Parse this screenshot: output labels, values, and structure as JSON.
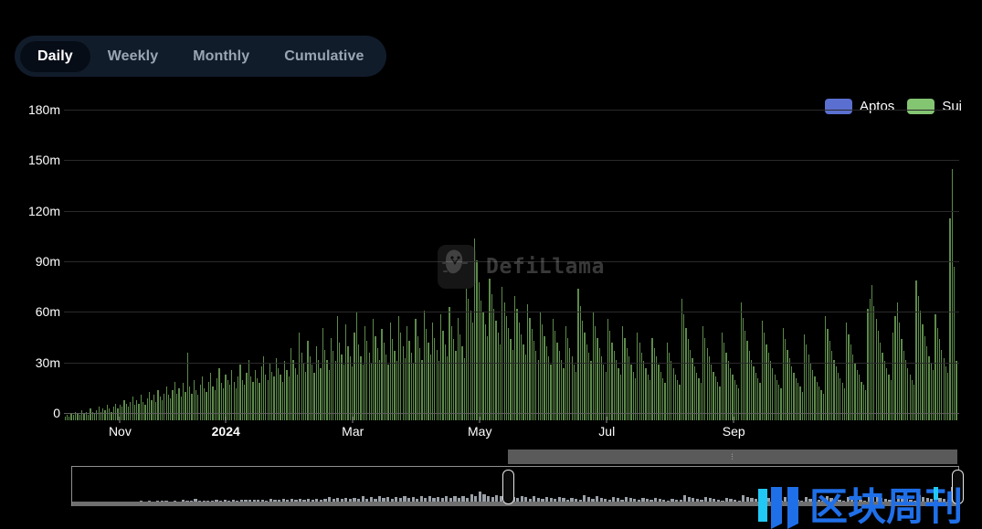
{
  "tabs": {
    "items": [
      {
        "label": "Daily",
        "active": true
      },
      {
        "label": "Weekly",
        "active": false
      },
      {
        "label": "Monthly",
        "active": false
      },
      {
        "label": "Cumulative",
        "active": false
      }
    ]
  },
  "legend": {
    "items": [
      {
        "label": "Aptos",
        "color": "#5b6fd0"
      },
      {
        "label": "Sui",
        "color": "#84c572"
      }
    ]
  },
  "watermark": {
    "text": "DefiLlama",
    "corner_text": "区块周刊",
    "corner_colors": [
      "#22c8f5",
      "#1f6fe8"
    ]
  },
  "brush": {
    "handle_left_label": "range-start-handle",
    "handle_right_label": "range-end-handle",
    "grip": "⫶"
  },
  "chart_data": {
    "type": "bar",
    "title": "",
    "xlabel": "",
    "ylabel": "",
    "stacked": true,
    "grid": true,
    "legend_position": "top-right",
    "ylim": [
      0,
      180
    ],
    "yticks": [
      0,
      30,
      60,
      90,
      120,
      150,
      180
    ],
    "ytick_labels": [
      "0",
      "30m",
      "60m",
      "90m",
      "120m",
      "150m",
      "180m"
    ],
    "unit": "m",
    "xtick_labels": [
      "Nov",
      "2024",
      "Mar",
      "May",
      "Jul",
      "Sep"
    ],
    "xtick_indices": [
      26,
      76,
      136,
      196,
      256,
      316
    ],
    "xtick_bold": [
      false,
      true,
      false,
      false,
      false,
      false
    ],
    "series": [
      {
        "name": "Sui",
        "color": "#5d8a4a",
        "values": [
          2,
          3,
          2,
          4,
          3,
          5,
          4,
          3,
          6,
          4,
          5,
          3,
          7,
          5,
          4,
          6,
          8,
          5,
          7,
          6,
          9,
          7,
          5,
          8,
          10,
          7,
          9,
          8,
          12,
          10,
          8,
          11,
          14,
          9,
          12,
          10,
          15,
          11,
          9,
          13,
          17,
          12,
          15,
          11,
          18,
          14,
          12,
          16,
          20,
          15,
          13,
          18,
          23,
          16,
          19,
          14,
          22,
          17,
          40,
          20,
          16,
          24,
          18,
          15,
          21,
          26,
          19,
          17,
          23,
          28,
          20,
          18,
          25,
          31,
          22,
          19,
          27,
          24,
          21,
          30,
          23,
          19,
          26,
          33,
          24,
          21,
          28,
          36,
          26,
          23,
          30,
          25,
          22,
          32,
          38,
          27,
          24,
          34,
          29,
          26,
          37,
          31,
          27,
          23,
          35,
          30,
          26,
          43,
          36,
          31,
          27,
          52,
          40,
          34,
          29,
          47,
          38,
          33,
          28,
          44,
          36,
          31,
          55,
          42,
          36,
          30,
          49,
          41,
          35,
          62,
          46,
          39,
          33,
          57,
          44,
          38,
          32,
          52,
          64,
          45,
          38,
          33,
          56,
          47,
          40,
          34,
          60,
          50,
          43,
          36,
          54,
          46,
          39,
          33,
          58,
          48,
          41,
          35,
          62,
          52,
          44,
          37,
          56,
          47,
          40,
          34,
          60,
          50,
          43,
          36,
          65,
          54,
          46,
          39,
          58,
          49,
          42,
          35,
          63,
          53,
          45,
          38,
          67,
          56,
          48,
          41,
          61,
          51,
          44,
          37,
          78,
          72,
          65,
          58,
          108,
          95,
          82,
          71,
          64,
          57,
          50,
          84,
          75,
          66,
          59,
          52,
          45,
          79,
          70,
          62,
          55,
          48,
          42,
          74,
          66,
          58,
          51,
          45,
          39,
          69,
          61,
          54,
          47,
          41,
          36,
          64,
          57,
          50,
          44,
          38,
          33,
          60,
          53,
          46,
          41,
          36,
          31,
          56,
          49,
          43,
          38,
          33,
          29,
          78,
          68,
          59,
          52,
          45,
          40,
          35,
          64,
          56,
          49,
          43,
          38,
          33,
          29,
          60,
          53,
          46,
          41,
          36,
          31,
          27,
          56,
          49,
          43,
          38,
          33,
          29,
          25,
          52,
          46,
          40,
          35,
          31,
          27,
          24,
          49,
          43,
          38,
          33,
          29,
          25,
          22,
          46,
          40,
          35,
          31,
          27,
          24,
          21,
          72,
          63,
          55,
          48,
          42,
          37,
          32,
          28,
          25,
          22,
          56,
          49,
          43,
          38,
          33,
          29,
          26,
          23,
          20,
          52,
          46,
          40,
          35,
          31,
          27,
          24,
          21,
          19,
          70,
          61,
          53,
          47,
          41,
          36,
          32,
          28,
          25,
          22,
          59,
          52,
          45,
          40,
          35,
          31,
          27,
          24,
          21,
          19,
          55,
          48,
          42,
          37,
          32,
          28,
          25,
          22,
          20,
          17,
          51,
          45,
          39,
          34,
          30,
          26,
          23,
          20,
          18,
          16,
          62,
          54,
          47,
          41,
          36,
          32,
          28,
          25,
          22,
          19,
          58,
          51,
          45,
          39,
          34,
          30,
          27,
          23,
          21,
          18,
          66,
          72,
          80,
          68,
          60,
          53,
          46,
          40,
          35,
          31,
          27,
          24,
          52,
          62,
          70,
          58,
          48,
          41,
          36,
          31,
          27,
          24,
          21,
          83,
          74,
          65,
          57,
          50,
          44,
          38,
          34,
          30,
          63,
          55,
          48,
          42,
          37,
          32,
          28,
          120,
          149,
          91,
          35
        ]
      },
      {
        "name": "Aptos",
        "color": "#5b6fd0",
        "values": []
      }
    ]
  }
}
